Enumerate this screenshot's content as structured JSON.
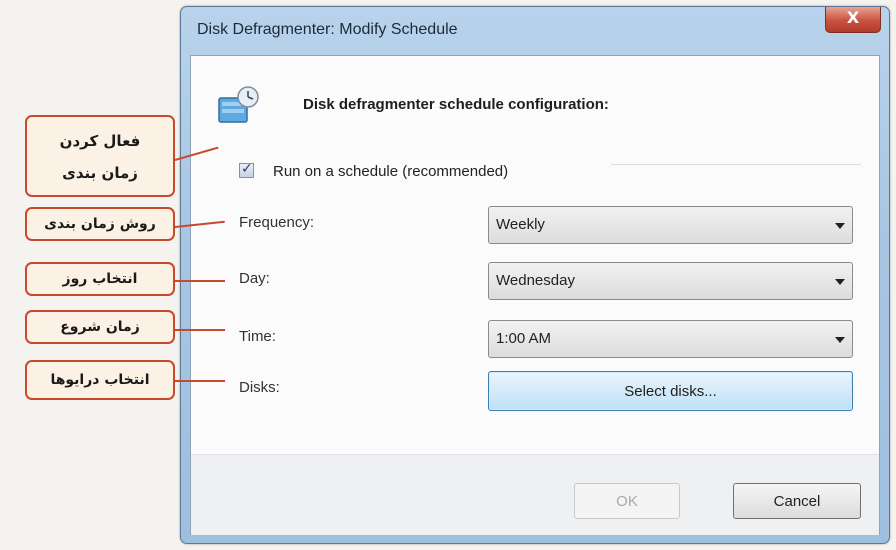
{
  "window": {
    "title": "Disk Defragmenter: Modify Schedule",
    "close_glyph": "X"
  },
  "header": {
    "title": "Disk defragmenter schedule configuration:",
    "icon": "defrag-schedule-icon"
  },
  "schedule": {
    "checkbox_label": "Run on a schedule (recommended)",
    "checked": true,
    "frequency_label": "Frequency:",
    "frequency_value": "Weekly",
    "day_label": "Day:",
    "day_value": "Wednesday",
    "time_label": "Time:",
    "time_value": "1:00 AM",
    "disks_label": "Disks:",
    "select_disks_label": "Select disks..."
  },
  "footer": {
    "ok_label": "OK",
    "cancel_label": "Cancel"
  },
  "annotations": {
    "enable_line1": "فعال کردن",
    "enable_line2": "زمان بندی",
    "method": "روش زمان بندی",
    "day": "انتخاب روز",
    "start_time": "زمان شروع",
    "disks": "انتخاب درایوها"
  },
  "colors": {
    "callout_border": "#c84a2c",
    "callout_fill": "#fbf1e4",
    "window_frame": "#a9c6e3",
    "close_button": "#c8523f",
    "select_button": "#bfe0f6"
  }
}
